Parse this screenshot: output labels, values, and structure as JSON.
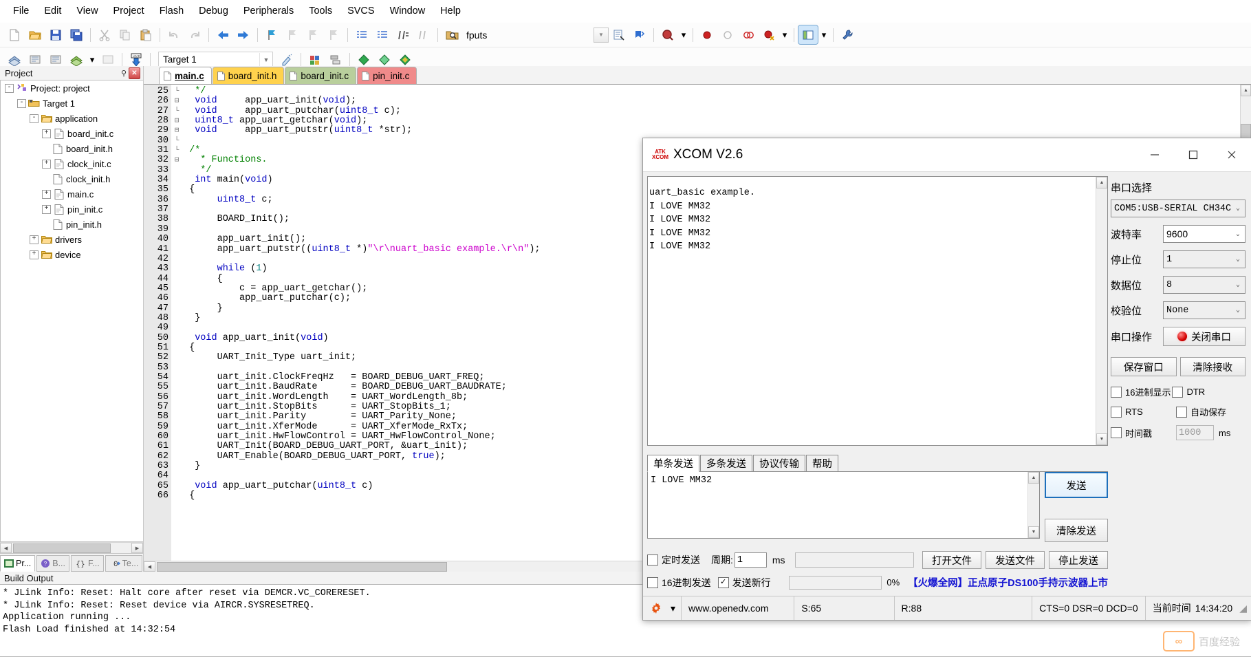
{
  "menu": {
    "items": [
      "File",
      "Edit",
      "View",
      "Project",
      "Flash",
      "Debug",
      "Peripherals",
      "Tools",
      "SVCS",
      "Window",
      "Help"
    ]
  },
  "toolbar2": {
    "target_value": "Target 1",
    "find_value": "fputs"
  },
  "project_panel": {
    "title": "Project",
    "tree": [
      {
        "label": "Project: project",
        "depth": 0,
        "expander": "-",
        "icon": "project-icon"
      },
      {
        "label": "Target 1",
        "depth": 1,
        "expander": "-",
        "icon": "target-icon"
      },
      {
        "label": "application",
        "depth": 2,
        "expander": "-",
        "icon": "folder-icon"
      },
      {
        "label": "board_init.c",
        "depth": 3,
        "expander": "+",
        "icon": "c-file-icon"
      },
      {
        "label": "board_init.h",
        "depth": 3,
        "expander": "",
        "icon": "h-file-icon"
      },
      {
        "label": "clock_init.c",
        "depth": 3,
        "expander": "+",
        "icon": "c-file-icon"
      },
      {
        "label": "clock_init.h",
        "depth": 3,
        "expander": "",
        "icon": "h-file-icon"
      },
      {
        "label": "main.c",
        "depth": 3,
        "expander": "+",
        "icon": "c-file-icon"
      },
      {
        "label": "pin_init.c",
        "depth": 3,
        "expander": "+",
        "icon": "c-file-icon"
      },
      {
        "label": "pin_init.h",
        "depth": 3,
        "expander": "",
        "icon": "h-file-icon"
      },
      {
        "label": "drivers",
        "depth": 2,
        "expander": "+",
        "icon": "folder-icon"
      },
      {
        "label": "device",
        "depth": 2,
        "expander": "+",
        "icon": "folder-icon"
      }
    ],
    "tabs": [
      {
        "label": "Pr...",
        "active": true
      },
      {
        "label": "B...",
        "active": false
      },
      {
        "label": "F...",
        "active": false
      },
      {
        "label": "Te...",
        "active": false
      }
    ]
  },
  "editor": {
    "tabs": [
      {
        "label": "main.c",
        "style": "t-main"
      },
      {
        "label": "board_init.h",
        "style": "t-yellow"
      },
      {
        "label": "board_init.c",
        "style": "t-green"
      },
      {
        "label": "pin_init.c",
        "style": "t-red"
      }
    ],
    "first_line": 25,
    "lines": [
      "  */",
      "  void     app_uart_init(void);",
      "  void     app_uart_putchar(uint8_t c);",
      "  uint8_t app_uart_getchar(void);",
      "  void     app_uart_putstr(uint8_t *str);",
      "",
      " /*",
      "   * Functions.",
      "   */",
      "  int main(void)",
      " {",
      "      uint8_t c;",
      "",
      "      BOARD_Init();",
      "",
      "      app_uart_init();",
      "      app_uart_putstr((uint8_t *)\"\\r\\nuart_basic example.\\r\\n\");",
      "",
      "      while (1)",
      "      {",
      "          c = app_uart_getchar();",
      "          app_uart_putchar(c);",
      "      }",
      "  }",
      "",
      "  void app_uart_init(void)",
      " {",
      "      UART_Init_Type uart_init;",
      "",
      "      uart_init.ClockFreqHz   = BOARD_DEBUG_UART_FREQ;",
      "      uart_init.BaudRate      = BOARD_DEBUG_UART_BAUDRATE;",
      "      uart_init.WordLength    = UART_WordLength_8b;",
      "      uart_init.StopBits      = UART_StopBits_1;",
      "      uart_init.Parity        = UART_Parity_None;",
      "      uart_init.XferMode      = UART_XferMode_RxTx;",
      "      uart_init.HwFlowControl = UART_HwFlowControl_None;",
      "      UART_Init(BOARD_DEBUG_UART_PORT, &uart_init);",
      "      UART_Enable(BOARD_DEBUG_UART_PORT, true);",
      "  }",
      "",
      "  void app_uart_putchar(uint8_t c)",
      " {"
    ]
  },
  "build_output": {
    "title": "Build Output",
    "lines": [
      "* JLink Info: Reset: Halt core after reset via DEMCR.VC_CORERESET.",
      "* JLink Info: Reset: Reset device via AIRCR.SYSRESETREQ.",
      "Application running ...",
      "Flash Load finished at 14:32:54"
    ]
  },
  "xcom": {
    "title": "XCOM V2.6",
    "logo_top": "ATK",
    "logo_bottom": "XCOM",
    "window_buttons": {
      "minimize": "minimize-button",
      "maximize": "maximize-button",
      "close": "close-button"
    },
    "receive_text": "uart_basic example.\nI LOVE MM32\nI LOVE MM32\nI LOVE MM32\nI LOVE MM32",
    "send_tabs": [
      {
        "label": "单条发送",
        "active": true
      },
      {
        "label": "多条发送",
        "active": false
      },
      {
        "label": "协议传输",
        "active": false
      },
      {
        "label": "帮助",
        "active": false
      }
    ],
    "send_text": "I LOVE MM32",
    "send_button": "发送",
    "clear_send_button": "清除发送",
    "right_panel": {
      "group_title": "串口选择",
      "port_value": "COM5:USB-SERIAL CH34C",
      "fields": [
        {
          "label": "波特率",
          "value": "9600",
          "white": true
        },
        {
          "label": "停止位",
          "value": "1",
          "white": false
        },
        {
          "label": "数据位",
          "value": "8",
          "white": false
        },
        {
          "label": "校验位",
          "value": "None",
          "white": false
        }
      ],
      "operation_label": "串口操作",
      "operation_button": "关闭串口",
      "save_window_button": "保存窗口",
      "clear_receive_button": "清除接收",
      "checkboxes": [
        {
          "label": "16进制显示",
          "checked": false
        },
        {
          "label": "DTR",
          "checked": false
        },
        {
          "label": "RTS",
          "checked": false
        },
        {
          "label": "自动保存",
          "checked": false
        },
        {
          "label": "时间戳",
          "checked": false
        }
      ],
      "timestamp_value": "1000",
      "timestamp_unit": "ms"
    },
    "bottom_options": {
      "timed_send_label": "定时发送",
      "timed_send_checked": false,
      "period_label": "周期:",
      "period_value": "1",
      "period_unit": "ms",
      "hex_send_label": "16进制发送",
      "hex_send_checked": false,
      "newline_label": "发送新行",
      "newline_checked": true,
      "progress_value": "0%",
      "open_file_button": "打开文件",
      "send_file_button": "发送文件",
      "stop_send_button": "停止发送",
      "ad_text": "【火爆全网】正点原子DS100手持示波器上市"
    },
    "status_bar": {
      "site": "www.openedv.com",
      "sent": "S:65",
      "received": "R:88",
      "signals": "CTS=0 DSR=0 DCD=0",
      "time_label": "当前时间",
      "time_value": "14:34:20"
    }
  },
  "watermark": {
    "text": "百度经验"
  },
  "colors": {
    "accent": "#1d6fbb",
    "tab_yellow": "#ffd24d",
    "tab_green": "#b9cf9c",
    "tab_red": "#f08a8a",
    "link": "#1414d2",
    "led_red": "#d40000"
  }
}
